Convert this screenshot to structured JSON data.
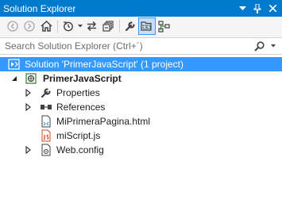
{
  "window": {
    "title": "Solution Explorer"
  },
  "titlebar_icons": [
    "dropdown-icon",
    "pin-icon",
    "close-icon"
  ],
  "toolbar": {
    "icons": [
      "back-icon",
      "forward-icon",
      "home-icon",
      "pending-changes-icon",
      "sync-icon",
      "collapse-all-icon",
      "properties-wrench-icon",
      "show-all-files-icon",
      "view-class-diagram-icon"
    ]
  },
  "search": {
    "placeholder": "Search Solution Explorer (Ctrl+´)"
  },
  "tree": {
    "solution_label": "Solution 'PrimerJavaScript' (1 project)",
    "project_label": "PrimerJavaScript",
    "items": [
      {
        "label": "Properties",
        "icon": "wrench-icon",
        "expandable": true
      },
      {
        "label": "References",
        "icon": "references-icon",
        "expandable": true
      },
      {
        "label": "MiPrimeraPagina.html",
        "icon": "html-file-icon",
        "expandable": false
      },
      {
        "label": "miScript.js",
        "icon": "js-file-icon",
        "expandable": false
      },
      {
        "label": "Web.config",
        "icon": "config-file-icon",
        "expandable": true
      }
    ]
  },
  "colors": {
    "titlebar": "#007acc",
    "selection": "#3399ff",
    "toolbar_bg": "#f5f5f5"
  }
}
